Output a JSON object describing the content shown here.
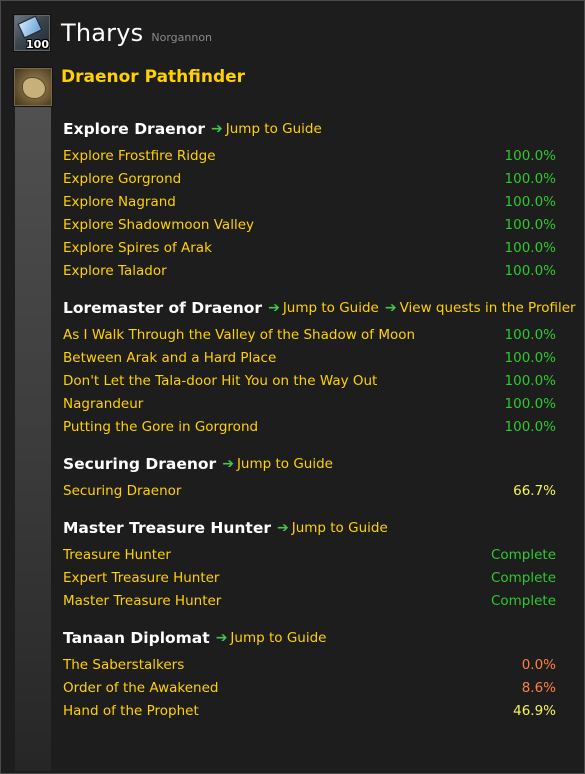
{
  "character": {
    "name": "Tharys",
    "realm": "Norgannon",
    "level_badge": "100",
    "icon": "character-portrait-icon"
  },
  "achievement": {
    "title": "Draenor Pathfinder",
    "icon": "map-icon"
  },
  "colors": {
    "gold": "#ffd100",
    "green": "#2ec92e",
    "yellow": "#f5f55a",
    "orange": "#ff8040",
    "arrow": "#3ec94a"
  },
  "sections": [
    {
      "title": "Explore Draenor",
      "links": [
        "Jump to Guide"
      ],
      "rows": [
        {
          "label": "Explore Frostfire Ridge",
          "value": "100.0%",
          "color": "green"
        },
        {
          "label": "Explore Gorgrond",
          "value": "100.0%",
          "color": "green"
        },
        {
          "label": "Explore Nagrand",
          "value": "100.0%",
          "color": "green"
        },
        {
          "label": "Explore Shadowmoon Valley",
          "value": "100.0%",
          "color": "green"
        },
        {
          "label": "Explore Spires of Arak",
          "value": "100.0%",
          "color": "green"
        },
        {
          "label": "Explore Talador",
          "value": "100.0%",
          "color": "green"
        }
      ]
    },
    {
      "title": "Loremaster of Draenor",
      "links": [
        "Jump to Guide",
        "View quests in the Profiler"
      ],
      "rows": [
        {
          "label": "As I Walk Through the Valley of the Shadow of Moon",
          "value": "100.0%",
          "color": "green"
        },
        {
          "label": "Between Arak and a Hard Place",
          "value": "100.0%",
          "color": "green"
        },
        {
          "label": "Don't Let the Tala-door Hit You on the Way Out",
          "value": "100.0%",
          "color": "green"
        },
        {
          "label": "Nagrandeur",
          "value": "100.0%",
          "color": "green"
        },
        {
          "label": "Putting the Gore in Gorgrond",
          "value": "100.0%",
          "color": "green"
        }
      ]
    },
    {
      "title": "Securing Draenor",
      "links": [
        "Jump to Guide"
      ],
      "rows": [
        {
          "label": "Securing Draenor",
          "value": "66.7%",
          "color": "yellow"
        }
      ]
    },
    {
      "title": "Master Treasure Hunter",
      "links": [
        "Jump to Guide"
      ],
      "rows": [
        {
          "label": "Treasure Hunter",
          "value": "Complete",
          "color": "green"
        },
        {
          "label": "Expert Treasure Hunter",
          "value": "Complete",
          "color": "green"
        },
        {
          "label": "Master Treasure Hunter",
          "value": "Complete",
          "color": "green"
        }
      ]
    },
    {
      "title": "Tanaan Diplomat",
      "links": [
        "Jump to Guide"
      ],
      "rows": [
        {
          "label": "The Saberstalkers",
          "value": "0.0%",
          "color": "orange"
        },
        {
          "label": "Order of the Awakened",
          "value": "8.6%",
          "color": "orange"
        },
        {
          "label": "Hand of the Prophet",
          "value": "46.9%",
          "color": "yellow"
        }
      ]
    }
  ]
}
